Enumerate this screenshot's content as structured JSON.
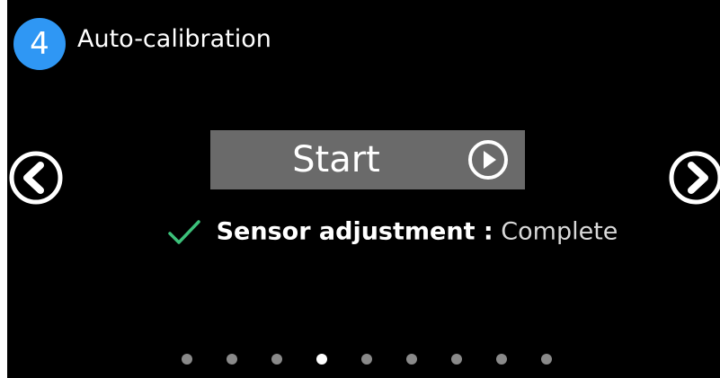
{
  "header": {
    "step_number": "4",
    "title": "Auto-calibration",
    "badge_color": "#2f97f4"
  },
  "nav": {
    "prev_icon": "chevron-left-circle-icon",
    "next_icon": "chevron-right-circle-icon"
  },
  "start_button": {
    "label": "Start",
    "icon": "play-circle-icon",
    "background": "#6a6a6a"
  },
  "status": {
    "icon": "checkmark-icon",
    "check_color": "#3cc17a",
    "label": "Sensor adjustment :",
    "value": "Complete"
  },
  "pager": {
    "total_pages": 9,
    "current_page": 4
  }
}
